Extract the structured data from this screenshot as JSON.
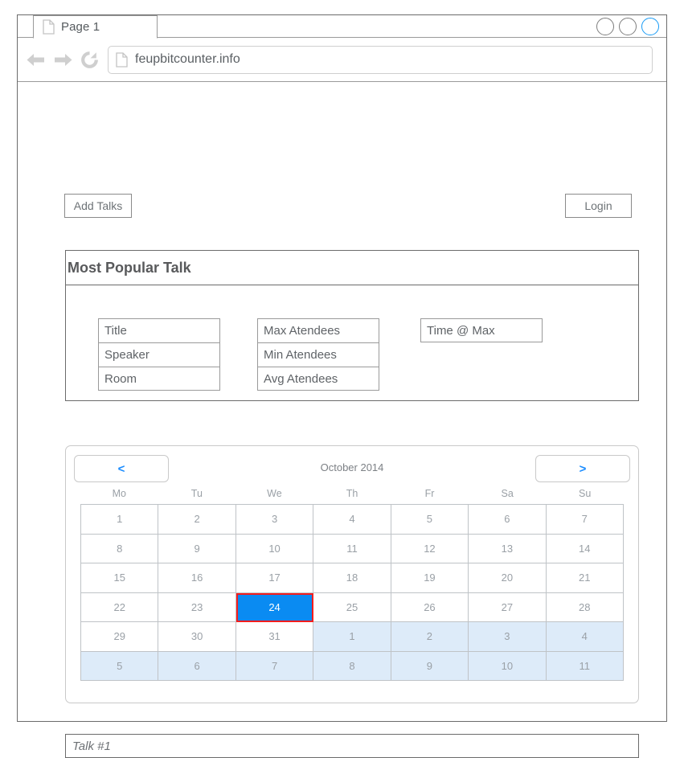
{
  "browser": {
    "tab": {
      "label": "Page 1",
      "icon": "page-icon"
    },
    "window_controls": [
      {
        "name": "window-button-1",
        "color": "#7d7d7d"
      },
      {
        "name": "window-button-2",
        "color": "#7d7d7d"
      },
      {
        "name": "window-button-3",
        "color": "#189bf5"
      }
    ],
    "nav": {
      "back_icon": "back-arrow-icon",
      "forward_icon": "forward-arrow-icon",
      "reload_icon": "reload-icon"
    },
    "url": "feupbitcounter.info",
    "url_icon": "page-icon"
  },
  "toolbar": {
    "add_talks_label": "Add Talks",
    "login_label": "Login"
  },
  "popular_talk": {
    "title": "Most Popular Talk",
    "columns": [
      {
        "name": "talk-details",
        "fields": [
          "Title",
          "Speaker",
          "Room"
        ]
      },
      {
        "name": "attendee-stats",
        "fields": [
          "Max Atendees",
          "Min Atendees",
          "Avg Atendees"
        ]
      },
      {
        "name": "time-at-max",
        "fields": [
          "Time @ Max"
        ]
      }
    ]
  },
  "calendar": {
    "prev_label": "<",
    "next_label": ">",
    "month_label": "October 2014",
    "weekdays": [
      "Mo",
      "Tu",
      "We",
      "Th",
      "Fr",
      "Sa",
      "Su"
    ],
    "selected_day": 24,
    "accent_color": "#0a8bf2",
    "selected_border_color": "#f51d1d",
    "other_month_color": "#ddebf9",
    "weeks": [
      [
        {
          "d": "1",
          "m": "cur"
        },
        {
          "d": "2",
          "m": "cur"
        },
        {
          "d": "3",
          "m": "cur"
        },
        {
          "d": "4",
          "m": "cur"
        },
        {
          "d": "5",
          "m": "cur"
        },
        {
          "d": "6",
          "m": "cur"
        },
        {
          "d": "7",
          "m": "cur"
        }
      ],
      [
        {
          "d": "8",
          "m": "cur"
        },
        {
          "d": "9",
          "m": "cur"
        },
        {
          "d": "10",
          "m": "cur"
        },
        {
          "d": "11",
          "m": "cur"
        },
        {
          "d": "12",
          "m": "cur"
        },
        {
          "d": "13",
          "m": "cur"
        },
        {
          "d": "14",
          "m": "cur"
        }
      ],
      [
        {
          "d": "15",
          "m": "cur"
        },
        {
          "d": "16",
          "m": "cur"
        },
        {
          "d": "17",
          "m": "cur"
        },
        {
          "d": "18",
          "m": "cur"
        },
        {
          "d": "19",
          "m": "cur"
        },
        {
          "d": "20",
          "m": "cur"
        },
        {
          "d": "21",
          "m": "cur"
        }
      ],
      [
        {
          "d": "22",
          "m": "cur"
        },
        {
          "d": "23",
          "m": "cur"
        },
        {
          "d": "24",
          "m": "sel"
        },
        {
          "d": "25",
          "m": "cur"
        },
        {
          "d": "26",
          "m": "cur"
        },
        {
          "d": "27",
          "m": "cur"
        },
        {
          "d": "28",
          "m": "cur"
        }
      ],
      [
        {
          "d": "29",
          "m": "cur"
        },
        {
          "d": "30",
          "m": "cur"
        },
        {
          "d": "31",
          "m": "cur"
        },
        {
          "d": "1",
          "m": "other"
        },
        {
          "d": "2",
          "m": "other"
        },
        {
          "d": "3",
          "m": "other"
        },
        {
          "d": "4",
          "m": "other"
        }
      ],
      [
        {
          "d": "5",
          "m": "other"
        },
        {
          "d": "6",
          "m": "other"
        },
        {
          "d": "7",
          "m": "other"
        },
        {
          "d": "8",
          "m": "other"
        },
        {
          "d": "9",
          "m": "other"
        },
        {
          "d": "10",
          "m": "other"
        },
        {
          "d": "11",
          "m": "other"
        }
      ]
    ]
  },
  "talk_field": {
    "value": "Talk #1"
  }
}
